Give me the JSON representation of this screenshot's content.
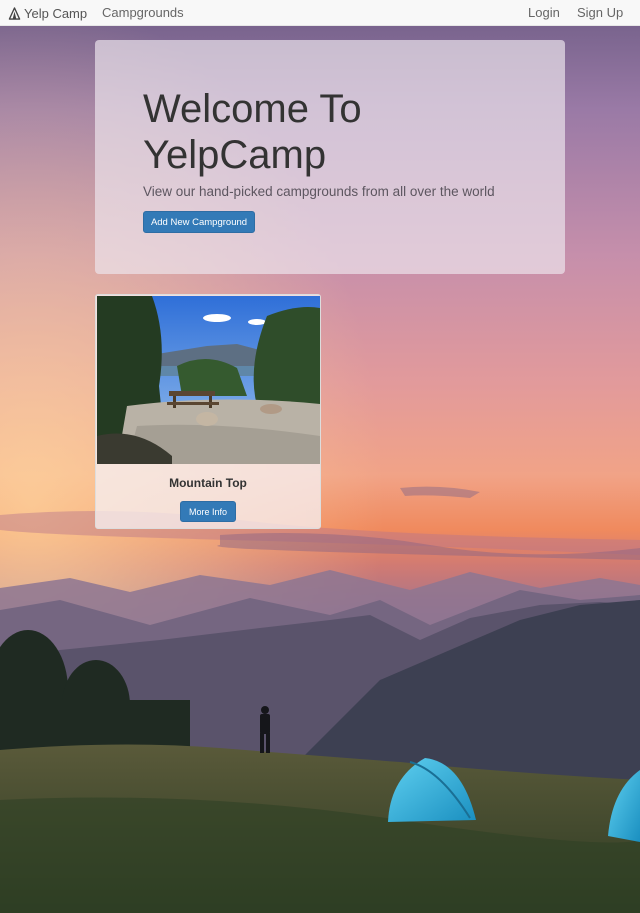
{
  "navbar": {
    "brand": "Yelp Camp",
    "brand_icon": "tent-icon",
    "links": {
      "campgrounds": "Campgrounds",
      "login": "Login",
      "signup": "Sign Up"
    }
  },
  "jumbotron": {
    "title": "Welcome To YelpCamp",
    "lead": "View our hand-picked campgrounds from all over the world",
    "button_label": "Add New Campground"
  },
  "campgrounds": [
    {
      "name": "Mountain Top",
      "button_label": "More Info"
    }
  ],
  "colors": {
    "primary": "#337ab7",
    "navbar_bg": "#f8f8f8",
    "text": "#333333"
  }
}
